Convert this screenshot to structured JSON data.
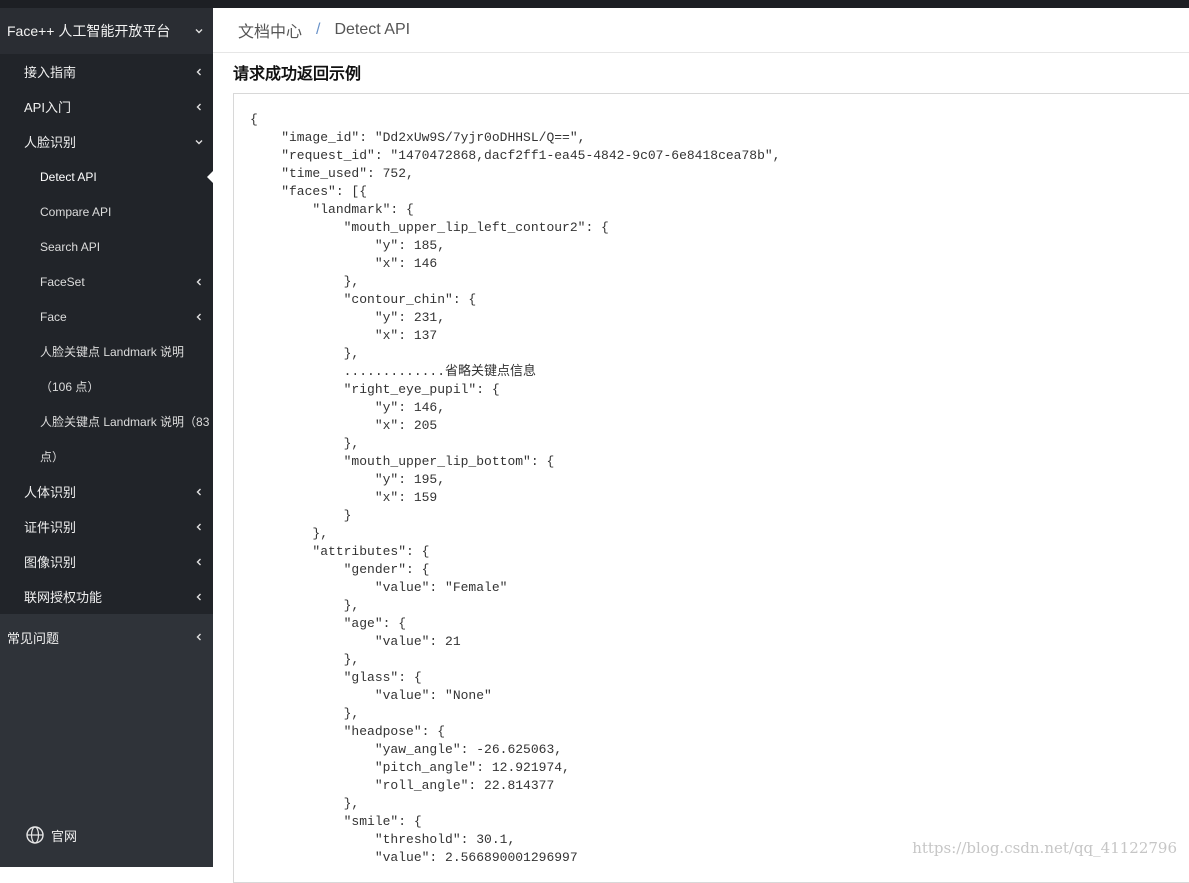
{
  "sidebar": {
    "platform_title": "Face++ 人工智能开放平台",
    "items": [
      {
        "label": "接入指南",
        "level": 1,
        "chevron": "left"
      },
      {
        "label": "API入门",
        "level": 1,
        "chevron": "left"
      },
      {
        "label": "人脸识别",
        "level": 1,
        "chevron": "down"
      },
      {
        "label": "Detect API",
        "level": 2,
        "active": true
      },
      {
        "label": "Compare API",
        "level": 2
      },
      {
        "label": "Search API",
        "level": 2
      },
      {
        "label": "FaceSet",
        "level": 2,
        "chevron": "left"
      },
      {
        "label": "Face",
        "level": 2,
        "chevron": "left"
      },
      {
        "label": "人脸关键点 Landmark 说明",
        "level": 2
      },
      {
        "label": "（106 点）",
        "level": 2
      },
      {
        "label": "人脸关键点 Landmark 说明（83",
        "level": 2
      },
      {
        "label": "点）",
        "level": 2
      },
      {
        "label": "人体识别",
        "level": 1,
        "chevron": "left"
      },
      {
        "label": "证件识别",
        "level": 1,
        "chevron": "left"
      },
      {
        "label": "图像识别",
        "level": 1,
        "chevron": "left"
      },
      {
        "label": "联网授权功能",
        "level": 1,
        "chevron": "left"
      }
    ],
    "faq_label": "常见问题",
    "footer_label": "官网",
    "footer_icon": "globe-icon"
  },
  "breadcrumb": {
    "root": "文档中心",
    "separator": "/",
    "current": "Detect API"
  },
  "section_title": "请求成功返回示例",
  "code_sample": "{\n    \"image_id\": \"Dd2xUw9S/7yjr0oDHHSL/Q==\",\n    \"request_id\": \"1470472868,dacf2ff1-ea45-4842-9c07-6e8418cea78b\",\n    \"time_used\": 752,\n    \"faces\": [{\n        \"landmark\": {\n            \"mouth_upper_lip_left_contour2\": {\n                \"y\": 185,\n                \"x\": 146\n            },\n            \"contour_chin\": {\n                \"y\": 231,\n                \"x\": 137\n            },\n            .............省略关键点信息\n            \"right_eye_pupil\": {\n                \"y\": 146,\n                \"x\": 205\n            },\n            \"mouth_upper_lip_bottom\": {\n                \"y\": 195,\n                \"x\": 159\n            }\n        },\n        \"attributes\": {\n            \"gender\": {\n                \"value\": \"Female\"\n            },\n            \"age\": {\n                \"value\": 21\n            },\n            \"glass\": {\n                \"value\": \"None\"\n            },\n            \"headpose\": {\n                \"yaw_angle\": -26.625063,\n                \"pitch_angle\": 12.921974,\n                \"roll_angle\": 22.814377\n            },\n            \"smile\": {\n                \"threshold\": 30.1,\n                \"value\": 2.566890001296997",
  "watermark": "https://blog.csdn.net/qq_41122796",
  "colors": {
    "sidebar_bg": "#2f3339",
    "sidebar_submenu_bg": "#212429",
    "breadcrumb_separator": "#6a93c9"
  }
}
